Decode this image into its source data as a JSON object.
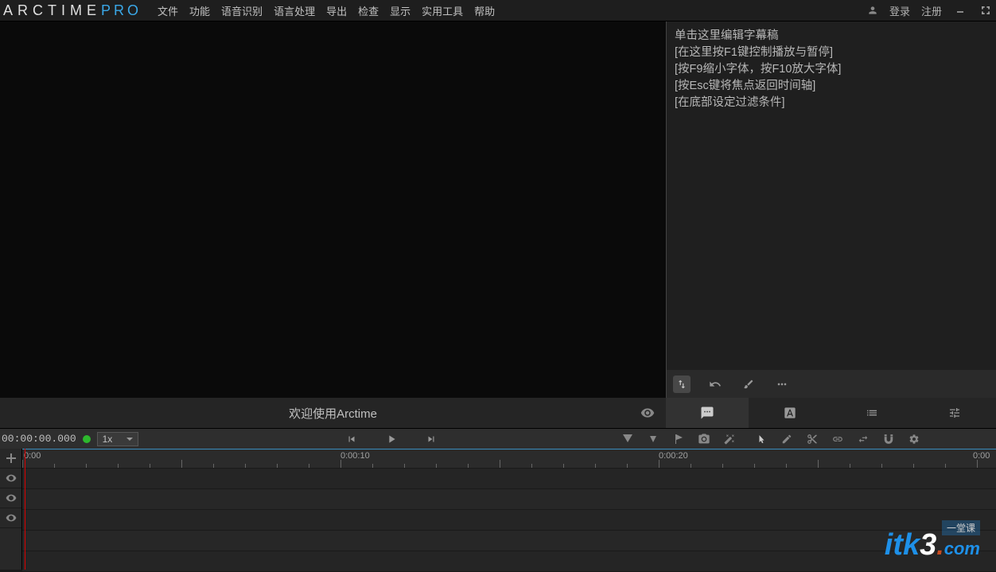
{
  "logo": {
    "arc": "ARCTIME",
    "pro": "PRO"
  },
  "menu": [
    "文件",
    "功能",
    "语音识别",
    "语言处理",
    "导出",
    "检查",
    "显示",
    "实用工具",
    "帮助"
  ],
  "auth": {
    "login": "登录",
    "register": "注册"
  },
  "editor": {
    "lines": [
      "单击这里编辑字幕稿",
      "[在这里按F1键控制播放与暂停]",
      "[按F9缩小字体，按F10放大字体]",
      "[按Esc键将焦点返回时间轴]",
      "[在底部设定过滤条件]"
    ]
  },
  "welcome": "欢迎使用Arctime",
  "playback": {
    "timecode": "00:00:00.000",
    "speed": "1x"
  },
  "ruler": {
    "labels": [
      {
        "pos": 2,
        "text": "0:00"
      },
      {
        "pos": 400,
        "text": "0:00:10"
      },
      {
        "pos": 800,
        "text": "0:00:20"
      },
      {
        "pos": 1200,
        "text": "0:00"
      }
    ]
  },
  "watermark": {
    "itk": "itk",
    "three": "3",
    "com": "com",
    "tag": "一堂课"
  }
}
